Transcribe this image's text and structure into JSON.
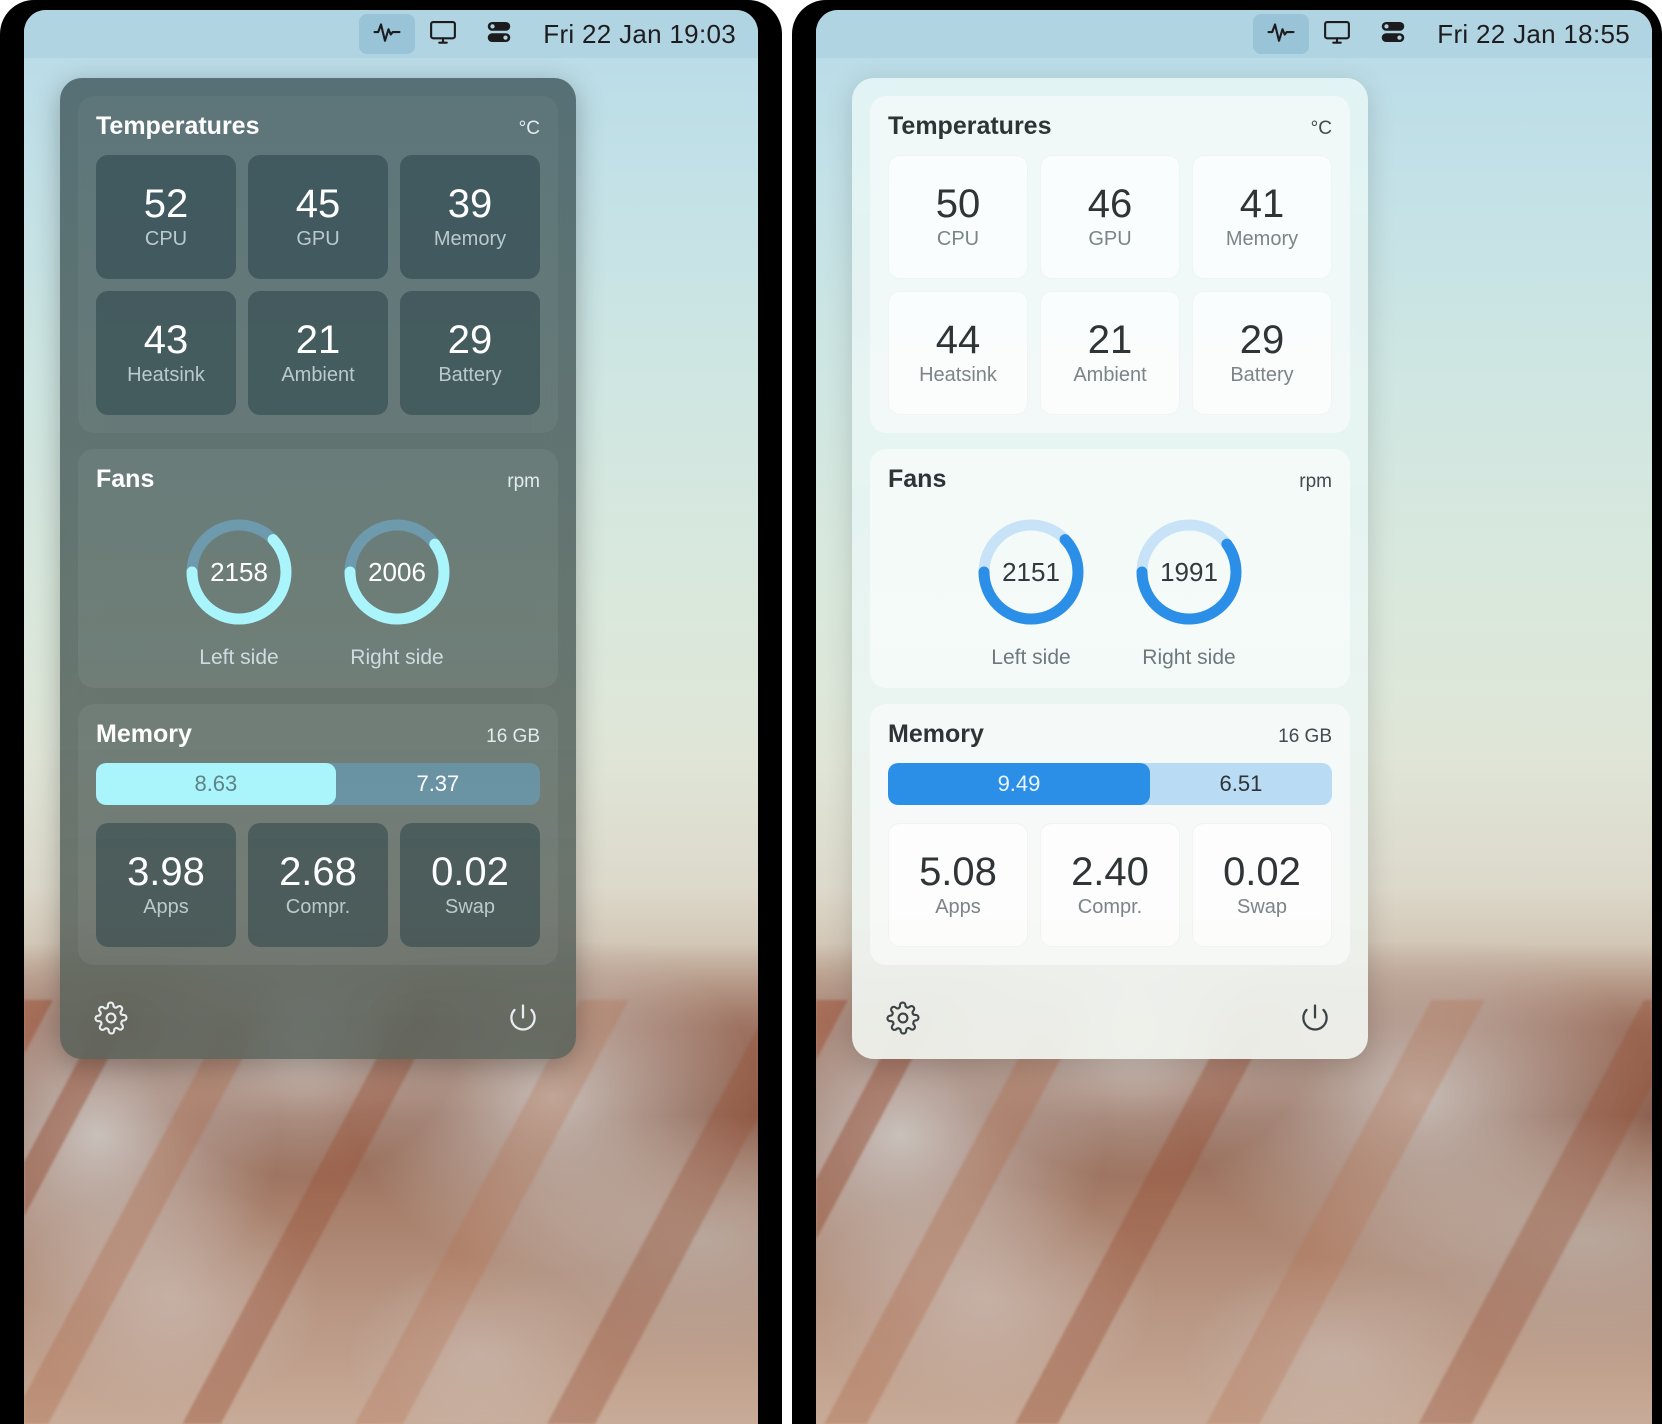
{
  "panels": [
    {
      "id": "dark-appearance",
      "menubar": {
        "icons": [
          "activity-pulse-icon",
          "display-icon",
          "toggles-icon"
        ],
        "clock": "Fri 22 Jan  19:03"
      },
      "temperatures": {
        "title": "Temperatures",
        "unit": "°C",
        "tiles": [
          {
            "value": "52",
            "label": "CPU"
          },
          {
            "value": "45",
            "label": "GPU"
          },
          {
            "value": "39",
            "label": "Memory"
          },
          {
            "value": "43",
            "label": "Heatsink"
          },
          {
            "value": "21",
            "label": "Ambient"
          },
          {
            "value": "29",
            "label": "Battery"
          }
        ]
      },
      "fans": {
        "title": "Fans",
        "unit": "rpm",
        "items": [
          {
            "value": "2158",
            "label": "Left side",
            "percent": 62
          },
          {
            "value": "2006",
            "label": "Right side",
            "percent": 60
          }
        ]
      },
      "memory": {
        "title": "Memory",
        "total": "16 GB",
        "used": "8.63",
        "free": "7.37",
        "used_percent": 54,
        "tiles": [
          {
            "value": "3.98",
            "label": "Apps"
          },
          {
            "value": "2.68",
            "label": "Compr."
          },
          {
            "value": "0.02",
            "label": "Swap"
          }
        ]
      },
      "footer": {
        "settings_icon": "gear-icon",
        "power_icon": "power-icon"
      }
    },
    {
      "id": "light-appearance",
      "menubar": {
        "icons": [
          "activity-pulse-icon",
          "display-icon",
          "toggles-icon"
        ],
        "clock": "Fri 22 Jan  18:55"
      },
      "temperatures": {
        "title": "Temperatures",
        "unit": "°C",
        "tiles": [
          {
            "value": "50",
            "label": "CPU"
          },
          {
            "value": "46",
            "label": "GPU"
          },
          {
            "value": "41",
            "label": "Memory"
          },
          {
            "value": "44",
            "label": "Heatsink"
          },
          {
            "value": "21",
            "label": "Ambient"
          },
          {
            "value": "29",
            "label": "Battery"
          }
        ]
      },
      "fans": {
        "title": "Fans",
        "unit": "rpm",
        "items": [
          {
            "value": "2151",
            "label": "Left side",
            "percent": 62
          },
          {
            "value": "1991",
            "label": "Right side",
            "percent": 60
          }
        ]
      },
      "memory": {
        "title": "Memory",
        "total": "16 GB",
        "used": "9.49",
        "free": "6.51",
        "used_percent": 59,
        "tiles": [
          {
            "value": "5.08",
            "label": "Apps"
          },
          {
            "value": "2.40",
            "label": "Compr."
          },
          {
            "value": "0.02",
            "label": "Swap"
          }
        ]
      },
      "footer": {
        "settings_icon": "gear-icon",
        "power_icon": "power-icon"
      }
    }
  ],
  "colors": {
    "accent_dark": "#aaf4fb",
    "accent_light": "#2b8fe8",
    "track_dark": "#6896aa",
    "track_light": "#b9dcf4",
    "menubar": "#b0d3e2"
  }
}
